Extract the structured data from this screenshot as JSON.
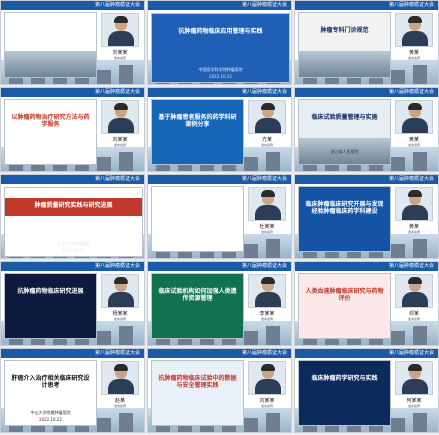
{
  "header_text": "第八届肿瘤循证大会",
  "colors": {
    "header": "#1b5aa6",
    "accent_red": "#c0392b",
    "navy": "#0d2a5c"
  },
  "tiles": [
    {
      "title": "",
      "subtitle": "",
      "date": "",
      "name": "刘某某",
      "info": "发言嘉宾"
    },
    {
      "title": "抗肿瘤药物临床应用管理与实践",
      "subtitle": "中国医学科学院肿瘤医院",
      "date": "2022.10.22",
      "name": "",
      "info": ""
    },
    {
      "title": "肿瘤专科门诊规范",
      "subtitle": "",
      "date": "",
      "name": "黄某",
      "info": "发言嘉宾"
    },
    {
      "title": "以肿瘤药物治疗研究方法与药学服务",
      "subtitle": "",
      "date": "",
      "name": "刘某某",
      "info": "发言嘉宾"
    },
    {
      "title": "基于肿瘤患者服务的药学科研案例分享",
      "subtitle": "",
      "date": "",
      "name": "方某",
      "info": "发言嘉宾"
    },
    {
      "title": "临床试验质量管理与实施",
      "subtitle": "浙江省人民医院",
      "date": "",
      "name": "黄某",
      "info": "发言嘉宾"
    },
    {
      "title": "肿瘤质量研究实践与研究进展",
      "subtitle": "北京大学肿瘤医院",
      "date": "2022.10.22",
      "name": "",
      "info": ""
    },
    {
      "title": "",
      "subtitle": "",
      "date": "",
      "name": "杜某某",
      "info": "发言嘉宾"
    },
    {
      "title": "临床肿瘤临床研究开展与发现经验肿瘤临床药学科建设",
      "subtitle": "",
      "date": "",
      "name": "黄某",
      "info": "发言嘉宾"
    },
    {
      "title": "抗肿瘤药物临床研究进展",
      "subtitle": "",
      "date": "",
      "name": "杨某某",
      "info": "发言嘉宾"
    },
    {
      "title": "临床试验机构如何加强人类遗传资源管理",
      "subtitle": "",
      "date": "",
      "name": "李某某",
      "info": "发言嘉宾"
    },
    {
      "title": "人类血液肿瘤临床研究与药物评价",
      "subtitle": "",
      "date": "",
      "name": "邓某",
      "info": "发言嘉宾"
    },
    {
      "title": "肝癌介入治疗相关临床研究设计思考",
      "subtitle": "中山大学附属肿瘤医院",
      "date": "2022.10.22",
      "name": "赵某",
      "info": "发言嘉宾"
    },
    {
      "title": "抗肿瘤药物临床试验中的数据与安全管理实践",
      "subtitle": "",
      "date": "",
      "name": "刘某某",
      "info": "发言嘉宾"
    },
    {
      "title": "临床肿瘤药学研究与实践",
      "subtitle": "",
      "date": "",
      "name": "何某某",
      "info": "发言嘉宾"
    }
  ]
}
